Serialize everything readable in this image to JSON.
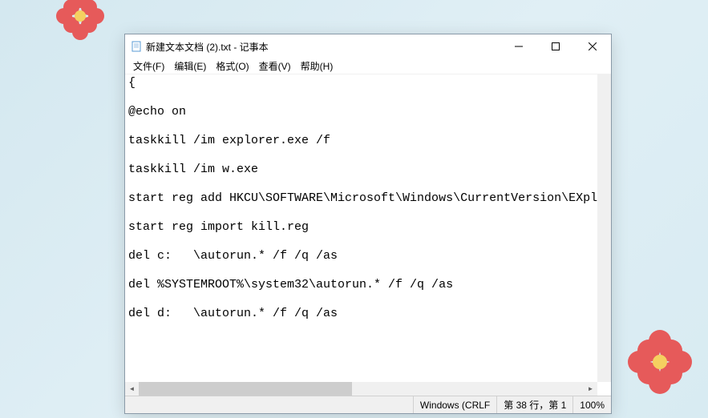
{
  "titlebar": {
    "title": "新建文本文档 (2).txt - 记事本"
  },
  "menubar": {
    "file": "文件(F)",
    "edit": "编辑(E)",
    "format": "格式(O)",
    "view": "查看(V)",
    "help": "帮助(H)"
  },
  "content": {
    "lines": [
      "{",
      "",
      "@echo on",
      "",
      "taskkill /im explorer.exe /f",
      "",
      "taskkill /im w.exe",
      "",
      "start reg add HKCU\\SOFTWARE\\Microsoft\\Windows\\CurrentVersion\\EXplorer",
      "",
      "start reg import kill.reg",
      "",
      "del c:   \\autorun.* /f /q /as",
      "",
      "del %SYSTEMROOT%\\system32\\autorun.* /f /q /as",
      "",
      "del d:   \\autorun.* /f /q /as"
    ]
  },
  "statusbar": {
    "encoding": "Windows (CRLF",
    "position": "第 38 行，第 1 ",
    "zoom": "100%"
  }
}
